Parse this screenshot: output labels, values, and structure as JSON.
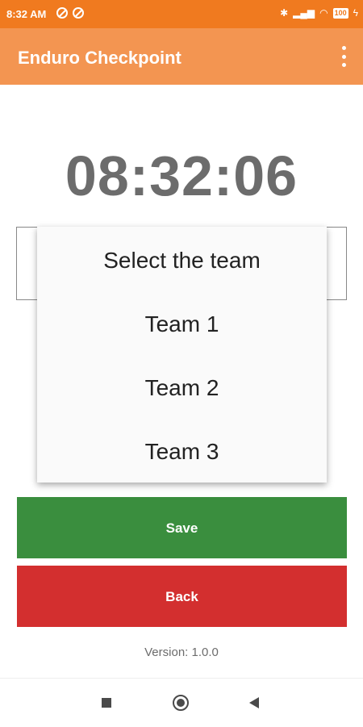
{
  "status_bar": {
    "time": "8:32 AM",
    "battery": "100",
    "icons": [
      "alarm-off-icon",
      "alarm-off-icon",
      "bluetooth-icon",
      "signal-icon",
      "wifi-icon",
      "battery-icon",
      "charging-icon"
    ]
  },
  "app_bar": {
    "title": "Enduro Checkpoint",
    "menu_icon": "more-vert-icon"
  },
  "clock": {
    "time": "08:32:06"
  },
  "team_dropdown": {
    "items": [
      {
        "label": "Select the team"
      },
      {
        "label": "Team 1"
      },
      {
        "label": "Team 2"
      },
      {
        "label": "Team 3"
      }
    ]
  },
  "actions": {
    "save_label": "Save",
    "back_label": "Back"
  },
  "footer": {
    "version": "Version: 1.0.0"
  },
  "colors": {
    "status_bar": "#f07a1f",
    "app_bar": "#f39551",
    "save": "#3a8e3e",
    "back": "#d32f2f"
  }
}
